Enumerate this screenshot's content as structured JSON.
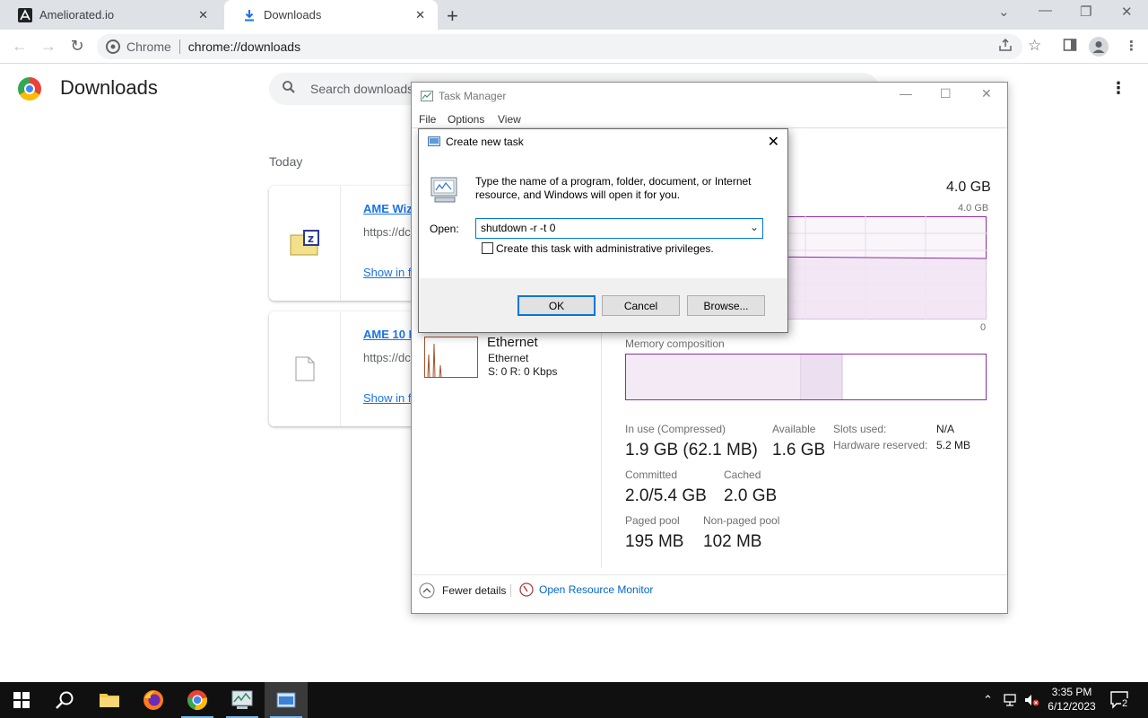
{
  "browser": {
    "tabs": [
      {
        "label": "Ameliorated.io"
      },
      {
        "label": "Downloads"
      }
    ],
    "omnibox": {
      "site_label": "Chrome",
      "url": "chrome://downloads"
    }
  },
  "downloads": {
    "title": "Downloads",
    "search_placeholder": "Search downloads",
    "section": "Today",
    "items": [
      {
        "name": "AME Wiz",
        "source": "https://dc",
        "action": "Show in f"
      },
      {
        "name": "AME 10 B",
        "source": "https://dc",
        "action": "Show in f"
      }
    ]
  },
  "task_manager": {
    "title": "Task Manager",
    "menu": [
      "File",
      "Options",
      "View"
    ],
    "memory_total": "4.0 GB",
    "graph_max": "4.0 GB",
    "graph_min": "0",
    "ethernet": {
      "title": "Ethernet",
      "subtitle": "Ethernet",
      "rate": "S: 0 R: 0 Kbps"
    },
    "memory_composition_label": "Memory composition",
    "stats": {
      "in_use_label": "In use (Compressed)",
      "in_use_value": "1.9 GB (62.1 MB)",
      "available_label": "Available",
      "available_value": "1.6 GB",
      "slots_label": "Slots used:",
      "slots_value": "N/A",
      "hw_label": "Hardware reserved:",
      "hw_value": "5.2 MB",
      "committed_label": "Committed",
      "committed_value": "2.0/5.4 GB",
      "cached_label": "Cached",
      "cached_value": "2.0 GB",
      "paged_label": "Paged pool",
      "paged_value": "195 MB",
      "nonpaged_label": "Non-paged pool",
      "nonpaged_value": "102 MB"
    },
    "footer": {
      "fewer_details": "Fewer details",
      "resource_monitor": "Open Resource Monitor"
    }
  },
  "run_dialog": {
    "title": "Create new task",
    "description": "Type the name of a program, folder, document, or Internet resource, and Windows will open it for you.",
    "open_label": "Open:",
    "open_value": "shutdown -r -t 0",
    "admin_checkbox_label": "Create this task with administrative privileges.",
    "admin_checked": false,
    "buttons": {
      "ok": "OK",
      "cancel": "Cancel",
      "browse": "Browse..."
    }
  },
  "taskbar": {
    "time": "3:35 PM",
    "date": "6/12/2023",
    "notification_count": "2"
  }
}
